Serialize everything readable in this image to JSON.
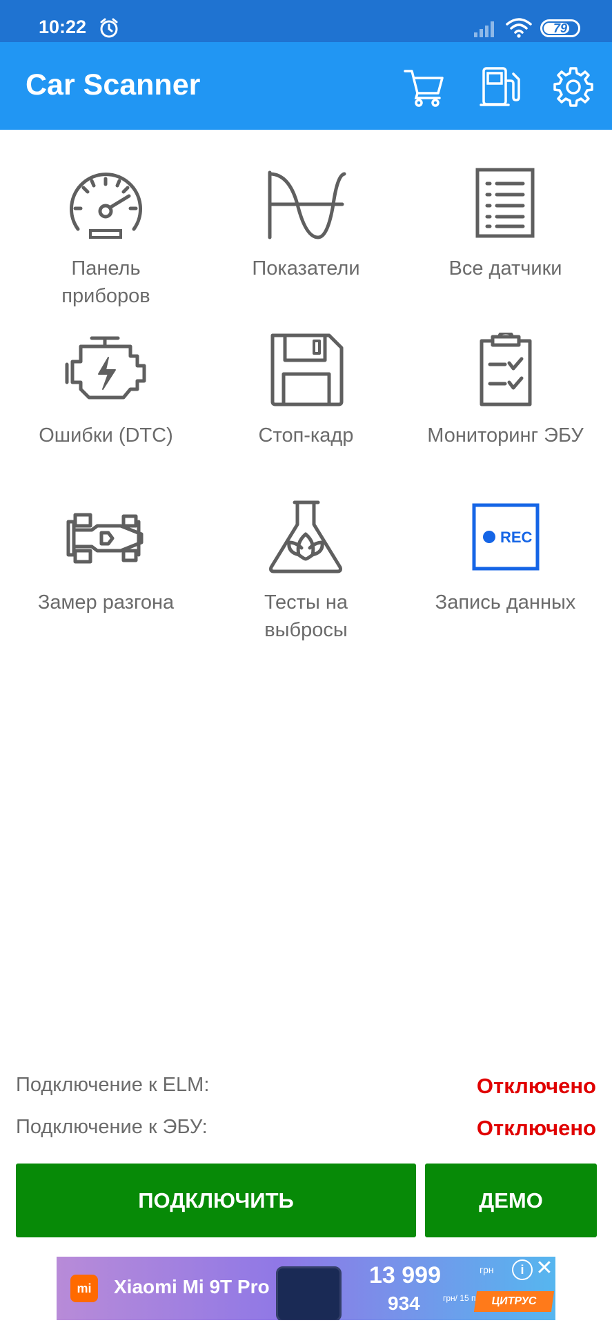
{
  "status_bar": {
    "time": "10:22",
    "battery": "79",
    "battery_level": 0.79
  },
  "app_bar": {
    "title": "Car Scanner"
  },
  "menu": [
    {
      "label": "Панель\nприборов",
      "icon": "dashboard-gauge-icon"
    },
    {
      "label": "Показатели",
      "icon": "graph-wave-icon"
    },
    {
      "label": "Все датчики",
      "icon": "sensors-list-icon"
    },
    {
      "label": "Ошибки (DTC)",
      "icon": "engine-error-icon"
    },
    {
      "label": "Стоп-кадр",
      "icon": "floppy-disk-icon"
    },
    {
      "label": "Мониторинг ЭБУ",
      "icon": "clipboard-check-icon"
    },
    {
      "label": "Замер разгона",
      "icon": "race-car-icon"
    },
    {
      "label": "Тесты на\nвыбросы",
      "icon": "eco-flask-icon"
    },
    {
      "label": "Запись данных",
      "icon": "rec-icon",
      "icon_text": "REC"
    }
  ],
  "connection": {
    "elm_label": "Подключение к ELM:",
    "elm_status": "Отключено",
    "ecu_label": "Подключение к ЭБУ:",
    "ecu_status": "Отключено"
  },
  "buttons": {
    "connect": "ПОДКЛЮЧИТЬ",
    "demo": "ДЕМО"
  },
  "ad": {
    "brand": "mi",
    "product": "Xiaomi Mi 9T Pro",
    "price": "13 999",
    "currency": "грн",
    "installment": "934",
    "installment_unit": "грн/ 15 пл.",
    "shop": "ЦИТРУС",
    "info": "i",
    "close": "✕"
  },
  "colors": {
    "status_bar": "#1f73d1",
    "app_bar": "#2196f3",
    "button": "#078a07",
    "status_off": "#e00000",
    "icon_gray": "#5f5f5f",
    "rec_blue": "#1565e6"
  }
}
